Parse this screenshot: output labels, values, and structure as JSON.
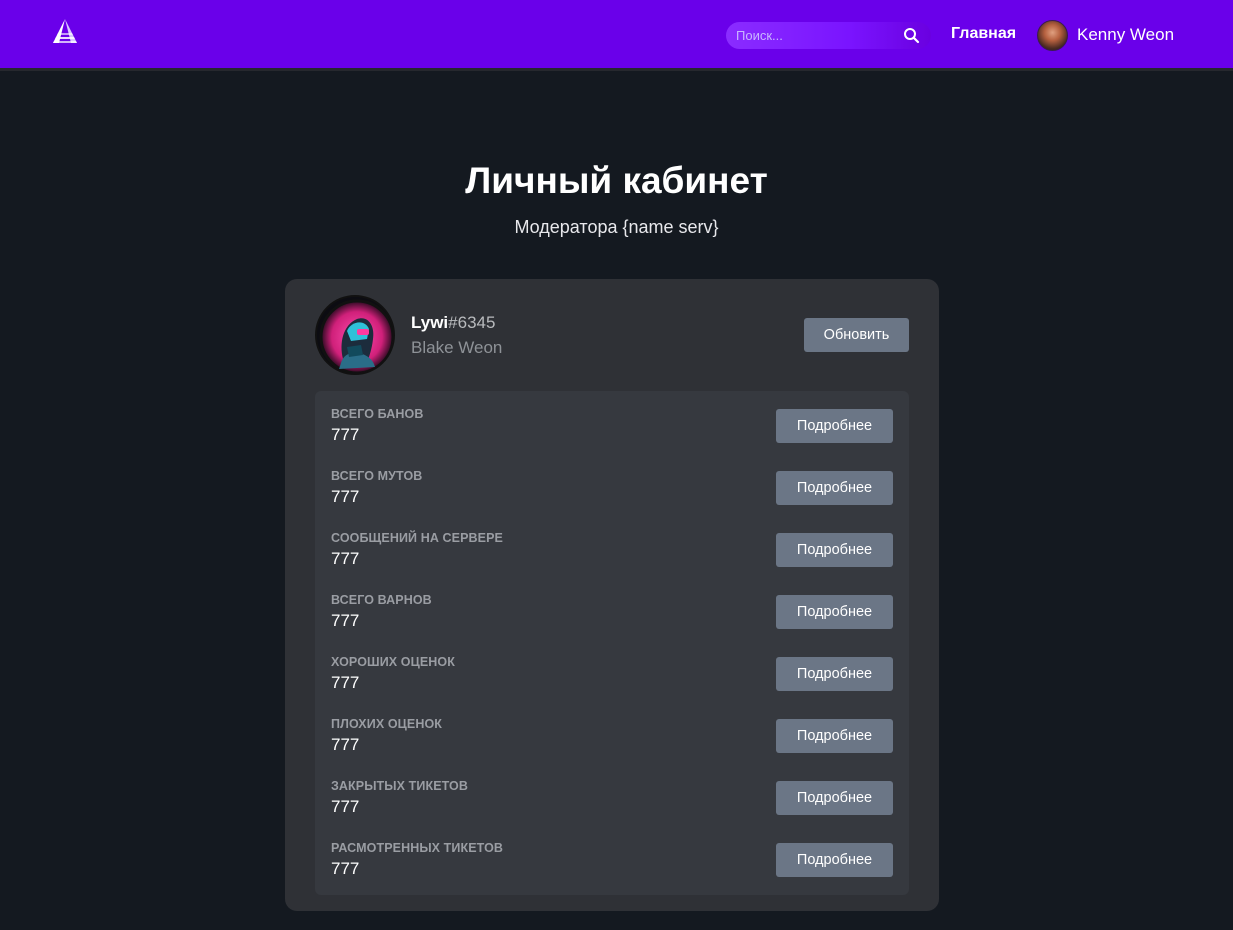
{
  "header": {
    "search_placeholder": "Поиск...",
    "nav_home": "Главная",
    "user_name": "Kenny Weon"
  },
  "page": {
    "title": "Личный кабинет",
    "subtitle": "Модератора {name serv}"
  },
  "profile": {
    "nick": "Lywi",
    "tag": "#6345",
    "real_name": "Blake Weon",
    "refresh_label": "Обновить"
  },
  "stats": [
    {
      "label": "Всего банов",
      "value": "777",
      "button": "Подробнее"
    },
    {
      "label": "Всего мутов",
      "value": "777",
      "button": "Подробнее"
    },
    {
      "label": "Сообщений на сервере",
      "value": "777",
      "button": "Подробнее"
    },
    {
      "label": "Всего варнов",
      "value": "777",
      "button": "Подробнее"
    },
    {
      "label": "Хороших оценок",
      "value": "777",
      "button": "Подробнее"
    },
    {
      "label": "Плохих оценок",
      "value": "777",
      "button": "Подробнее"
    },
    {
      "label": "Закрытых тикетов",
      "value": "777",
      "button": "Подробнее"
    },
    {
      "label": "Расмотренных тикетов",
      "value": "777",
      "button": "Подробнее"
    }
  ],
  "colors": {
    "header_bg": "#6a00ea",
    "page_bg": "#141920",
    "card_bg": "#2f3136",
    "stats_bg": "#36393f",
    "button_bg": "#6b7686"
  },
  "icons": {
    "logo": "triangle-logo-icon",
    "search": "search-icon"
  }
}
